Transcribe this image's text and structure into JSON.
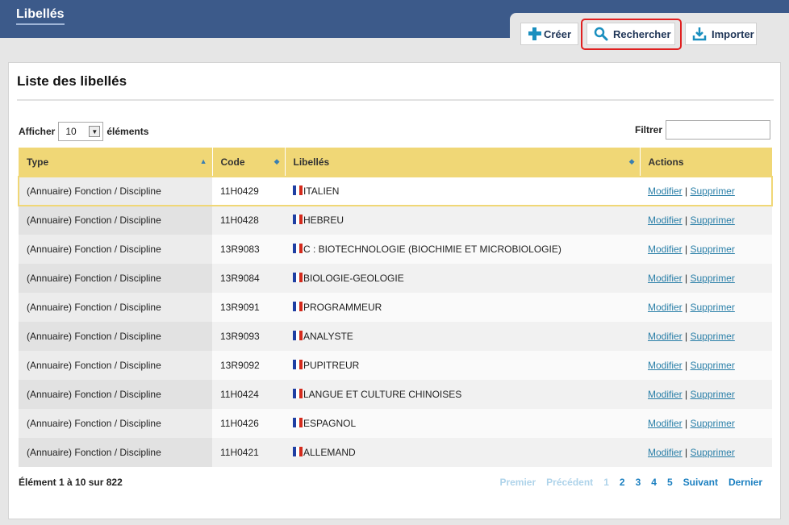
{
  "header": {
    "title": "Libellés"
  },
  "toolbar": {
    "create_label": "Créer",
    "search_label": "Rechercher",
    "import_label": "Importer"
  },
  "panel": {
    "title": "Liste des libellés"
  },
  "length": {
    "prefix": "Afficher",
    "value": "10",
    "suffix": "éléments"
  },
  "filter": {
    "label": "Filtrer",
    "value": ""
  },
  "table": {
    "headers": [
      "Type",
      "Code",
      "Libellés",
      "Actions"
    ],
    "rows": [
      {
        "type": "(Annuaire) Fonction / Discipline",
        "code": "11H0429",
        "label": "ITALIEN"
      },
      {
        "type": "(Annuaire) Fonction / Discipline",
        "code": "11H0428",
        "label": "HEBREU"
      },
      {
        "type": "(Annuaire) Fonction / Discipline",
        "code": "13R9083",
        "label": "C : BIOTECHNOLOGIE (BIOCHIMIE ET MICROBIOLOGIE)"
      },
      {
        "type": "(Annuaire) Fonction / Discipline",
        "code": "13R9084",
        "label": "BIOLOGIE-GEOLOGIE"
      },
      {
        "type": "(Annuaire) Fonction / Discipline",
        "code": "13R9091",
        "label": "PROGRAMMEUR"
      },
      {
        "type": "(Annuaire) Fonction / Discipline",
        "code": "13R9093",
        "label": "ANALYSTE"
      },
      {
        "type": "(Annuaire) Fonction / Discipline",
        "code": "13R9092",
        "label": "PUPITREUR"
      },
      {
        "type": "(Annuaire) Fonction / Discipline",
        "code": "11H0424",
        "label": "LANGUE ET CULTURE CHINOISES"
      },
      {
        "type": "(Annuaire) Fonction / Discipline",
        "code": "11H0426",
        "label": "ESPAGNOL"
      },
      {
        "type": "(Annuaire) Fonction / Discipline",
        "code": "11H0421",
        "label": "ALLEMAND"
      }
    ],
    "action_edit": "Modifier",
    "action_sep": "|",
    "action_delete": "Supprimer"
  },
  "footer": {
    "info": "Élément 1 à 10 sur 822"
  },
  "pagination": {
    "first": "Premier",
    "prev": "Précédent",
    "pages": [
      "1",
      "2",
      "3",
      "4",
      "5"
    ],
    "next": "Suivant",
    "last": "Dernier",
    "current": "1"
  },
  "icons": {
    "create": "plus-icon",
    "search": "magnifier-icon",
    "import": "download-icon",
    "flag": "french-flag-icon"
  },
  "colors": {
    "header_bar": "#3c5a8a",
    "table_header": "#f0d776",
    "accent": "#1a8fbf",
    "highlight": "#e02020"
  }
}
